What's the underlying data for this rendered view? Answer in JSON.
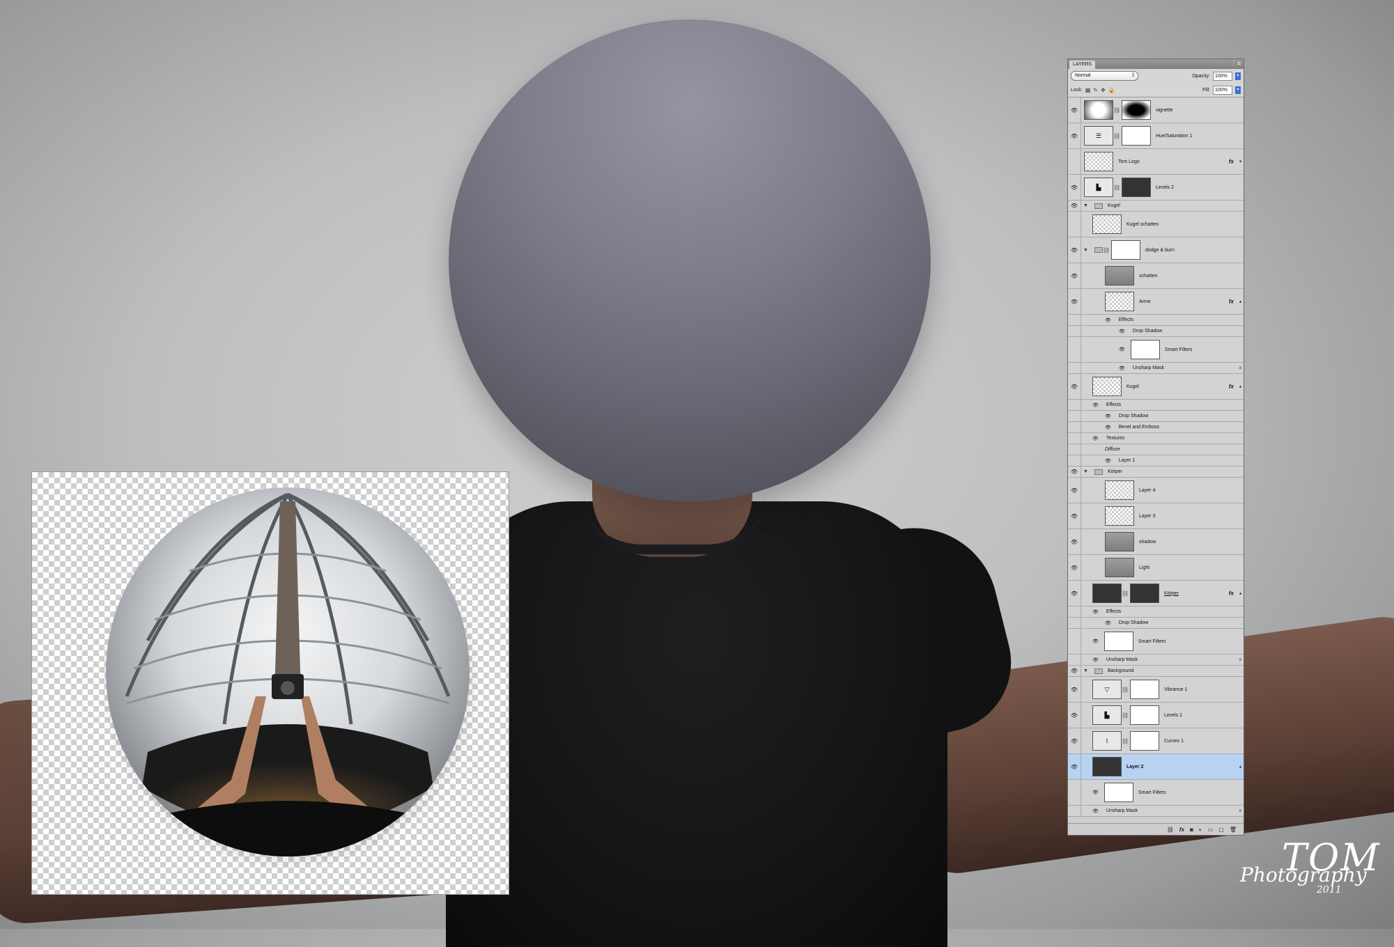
{
  "panel": {
    "tab_title": "LAYERS",
    "blend_mode": "Normal",
    "opacity_label": "Opacity:",
    "opacity_value": "100%",
    "lock_label": "Lock:",
    "fill_label": "Fill:",
    "fill_value": "100%"
  },
  "layers": {
    "vignette": "vignette",
    "huesat": "Hue/Saturation 1",
    "tomlogo": "Tom Logo",
    "levels2": "Levels 2",
    "kugel_group": "Kugel",
    "kugel_schatten": "Kugel schatten",
    "dodge_burn": "dodge & burn",
    "schatten": "schatten",
    "arme": "Arme",
    "arme_effects": "Effects",
    "arme_dropshadow": "Drop Shadow",
    "arme_smartfilters": "Smart Filters",
    "arme_unsharp": "Unsharp Mask",
    "kugel": "Kugel",
    "kugel_effects": "Effects",
    "kugel_dropshadow": "Drop Shadow",
    "kugel_bevel": "Bevel and Emboss",
    "kugel_textures": "Textures",
    "kugel_diffuse": "Diffuse",
    "kugel_layer1": "Layer 1",
    "koerper_group": "Körper",
    "layer4": "Layer 4",
    "layer3": "Layer 3",
    "shadow": "shadow",
    "light": "Light",
    "koerper": "Körper",
    "koerper_effects": "Effects",
    "koerper_dropshadow": "Drop Shadow",
    "koerper_smartfilters": "Smart Filters",
    "koerper_unsharp": "Unsharp Mask",
    "background_group": "Background",
    "vibrance1": "Vibrance 1",
    "levels1": "Levels 1",
    "curves1": "Curves 1",
    "layer2": "Layer 2",
    "layer2_smartfilters": "Smart Filters",
    "layer2_unsharp": "Unsharp Mask"
  },
  "logo": {
    "mark": "TOM",
    "text": "Photography",
    "year": "2011"
  },
  "icons": {
    "eye": "eye-icon",
    "fx": "fx-icon",
    "chain": "link-icon",
    "folder": "folder-icon"
  },
  "colors": {
    "selected_row": "#b8d2f2",
    "panel_bg": "#d6d6d6",
    "accent": "#3b6fd4"
  }
}
